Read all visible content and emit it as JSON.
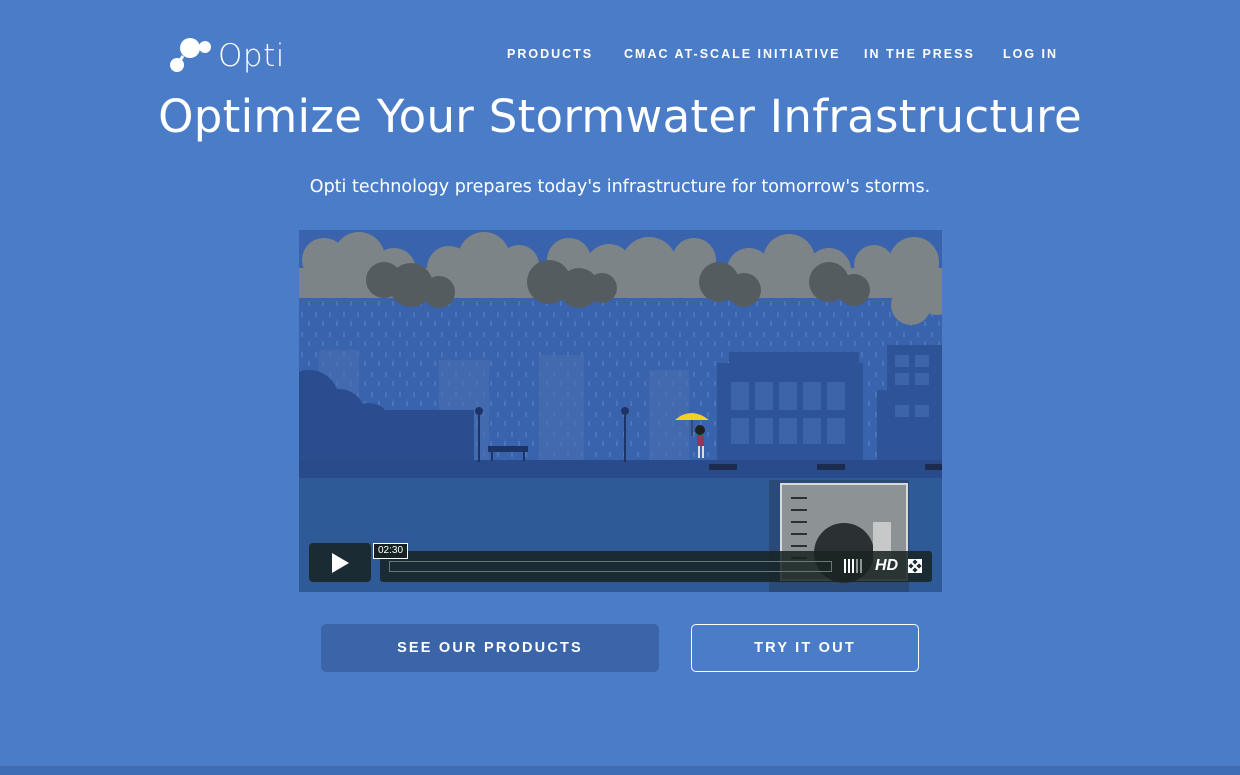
{
  "brand": {
    "name": "Opti",
    "logo_icon": "molecule-logo-icon"
  },
  "nav": {
    "items": [
      {
        "label": "PRODUCTS"
      },
      {
        "label": "CMAC AT-SCALE INITIATIVE"
      },
      {
        "label": "IN THE PRESS"
      },
      {
        "label": "LOG IN"
      }
    ]
  },
  "hero": {
    "title": "Optimize Your Stormwater Infrastructure",
    "subtitle": "Opti technology prepares today's infrastructure for tomorrow's storms."
  },
  "video": {
    "time": "02:30",
    "progress": 0,
    "quality_label": "HD",
    "play_icon": "play-icon",
    "fullscreen_icon": "fullscreen-icon",
    "volume_icon": "volume-bars-icon"
  },
  "cta": {
    "primary_label": "SEE OUR PRODUCTS",
    "secondary_label": "TRY IT OUT"
  },
  "colors": {
    "background": "#4a7cc8",
    "sky": "#3a63ad",
    "cloud_light": "#7d8488",
    "cloud_dark": "#555c60",
    "primary_button": "#3c65a9",
    "player_bar": "#172322"
  }
}
